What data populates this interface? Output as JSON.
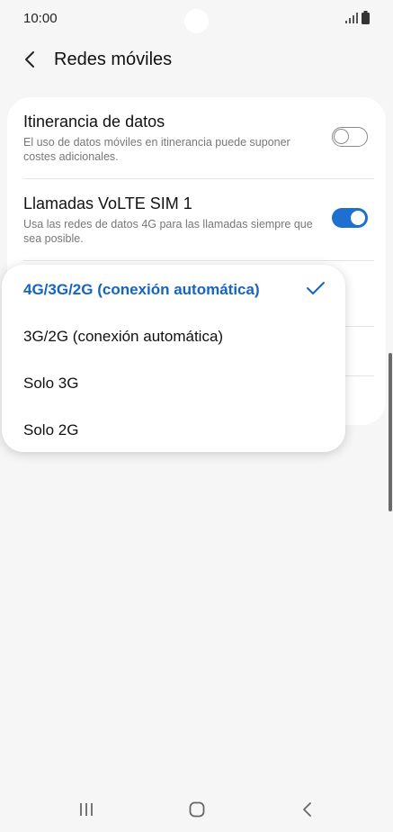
{
  "status_bar": {
    "time": "10:00"
  },
  "app_bar": {
    "title": "Redes móviles"
  },
  "settings": [
    {
      "title": "Itinerancia de datos",
      "description": "El uso de datos móviles en itinerancia puede suponer costes adicionales.",
      "enabled": false
    },
    {
      "title": "Llamadas VoLTE SIM 1",
      "description": "Usa las redes de datos 4G para las llamadas siempre que sea posible.",
      "enabled": true
    }
  ],
  "network_mode_menu": {
    "options": [
      "4G/3G/2G (conexión automática)",
      "3G/2G (conexión automática)",
      "Solo 3G",
      "Solo 2G"
    ],
    "selected_index": 0
  },
  "colors": {
    "accent": "#1e6fd0",
    "selected_text": "#1565c0",
    "background": "#f6f6f6"
  },
  "icons": {
    "back": "chevron-left-icon",
    "check": "check-icon",
    "signal": "signal-icon",
    "battery": "battery-icon",
    "nav_recents": "recents-icon",
    "nav_home": "home-icon",
    "nav_back": "back-icon"
  }
}
